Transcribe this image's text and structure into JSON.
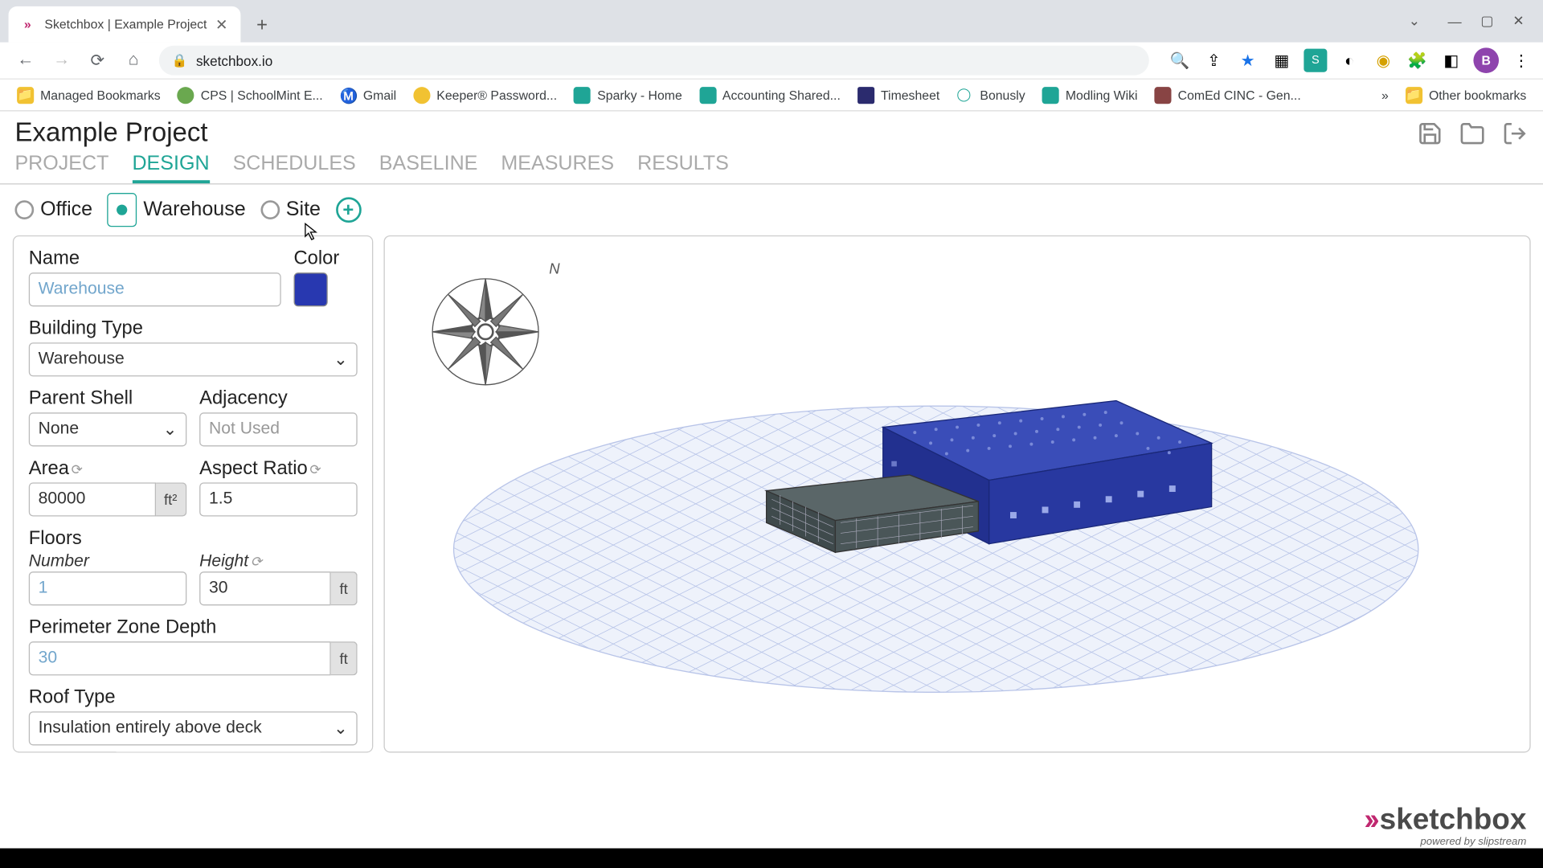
{
  "browser": {
    "tab_title": "Sketchbox | Example Project",
    "url": "sketchbox.io",
    "window_controls": {
      "min": "—",
      "max": "▢",
      "close": "✕",
      "dropdown": "⌄"
    },
    "nav": {
      "back": "←",
      "fwd": "→",
      "reload": "⟳",
      "home": "⌂"
    },
    "bookmarks": [
      {
        "label": "Managed Bookmarks"
      },
      {
        "label": "CPS | SchoolMint E..."
      },
      {
        "label": "Gmail"
      },
      {
        "label": "Keeper® Password..."
      },
      {
        "label": "Sparky - Home"
      },
      {
        "label": "Accounting Shared..."
      },
      {
        "label": "Timesheet"
      },
      {
        "label": "Bonusly"
      },
      {
        "label": "Modling Wiki"
      },
      {
        "label": "ComEd CINC - Gen..."
      }
    ],
    "bm_overflow": "»",
    "other_bookmarks": "Other bookmarks",
    "avatar_letter": "B"
  },
  "app": {
    "title": "Example Project",
    "main_tabs": [
      "PROJECT",
      "DESIGN",
      "SCHEDULES",
      "BASELINE",
      "MEASURES",
      "RESULTS"
    ],
    "active_tab": "DESIGN",
    "sub_items": [
      {
        "label": "Office",
        "selected": false
      },
      {
        "label": "Warehouse",
        "selected": true
      },
      {
        "label": "Site",
        "selected": false
      }
    ],
    "form": {
      "name_label": "Name",
      "name_value": "Warehouse",
      "color_label": "Color",
      "color_value": "#2838B0",
      "building_type_label": "Building Type",
      "building_type_value": "Warehouse",
      "parent_shell_label": "Parent Shell",
      "parent_shell_value": "None",
      "adjacency_label": "Adjacency",
      "adjacency_value": "Not Used",
      "area_label": "Area",
      "area_value": "80000",
      "area_unit": "ft²",
      "aspect_label": "Aspect Ratio",
      "aspect_value": "1.5",
      "floors_label": "Floors",
      "floors_number_label": "Number",
      "floors_number_value": "1",
      "floors_height_label": "Height",
      "floors_height_value": "30",
      "floors_height_unit": "ft",
      "pzd_label": "Perimeter Zone Depth",
      "pzd_value": "30",
      "pzd_unit": "ft",
      "roof_label": "Roof Type",
      "roof_value": "Insulation entirely above deck"
    },
    "compass_n": "N",
    "brand": "sketchbox",
    "brand_sub": "powered by slipstream"
  }
}
